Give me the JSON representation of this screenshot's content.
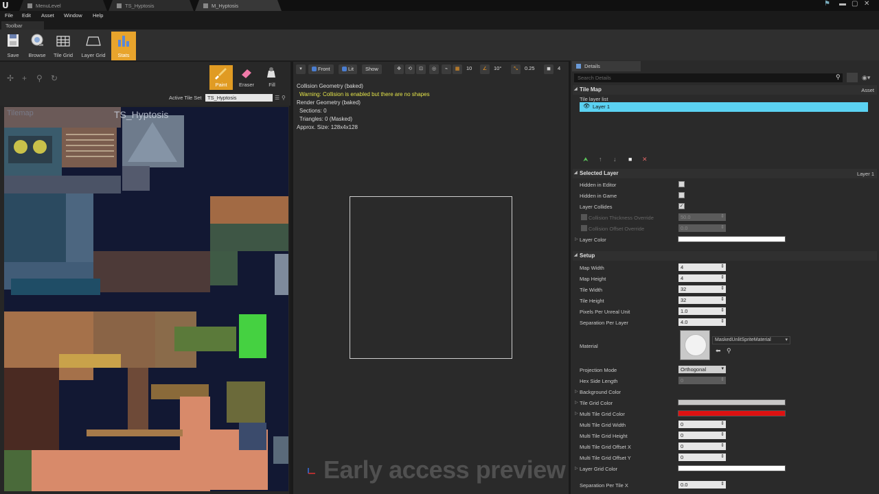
{
  "window": {
    "logo": "U",
    "tabs": [
      "MenuLevel",
      "TS_Hyptosis",
      "M_Hyptosis"
    ],
    "controls": {
      "user": "⚑",
      "minimize": "▬",
      "maximize": "▢",
      "close": "✕"
    }
  },
  "menu": [
    "File",
    "Edit",
    "Asset",
    "Window",
    "Help"
  ],
  "toolbar": {
    "tab_label": "Toolbar",
    "buttons": [
      {
        "label": "Save",
        "icon": "save-icon"
      },
      {
        "label": "Browse",
        "icon": "browse-icon"
      },
      {
        "label": "Tile Grid",
        "icon": "tile-grid-icon"
      },
      {
        "label": "Layer Grid",
        "icon": "layer-grid-icon"
      },
      {
        "label": "Stats",
        "icon": "stats-icon",
        "active": true
      }
    ]
  },
  "tools": {
    "buttons": [
      {
        "label": "Paint",
        "icon": "paint-brush-icon",
        "active": true
      },
      {
        "label": "Eraser",
        "icon": "eraser-icon"
      },
      {
        "label": "Fill",
        "icon": "fill-bucket-icon"
      }
    ],
    "active_tile_set_label": "Active Tile Set",
    "active_tile_set_value": "TS_Hyptosis",
    "tileset_title": "TS_Hyptosis",
    "tileset_subtitle": "Tilemap"
  },
  "viewport": {
    "buttons": {
      "view": "Front",
      "lit": "Lit",
      "show": "Show"
    },
    "grid_snap": "10",
    "rot_snap": "10°",
    "scale_snap": "0.25",
    "cam_speed": "4",
    "info": {
      "line1": "Collision Geometry (baked)",
      "warning": "Warning: Collision is enabled but there are no shapes",
      "line3": "Render Geometry (baked)",
      "sections": "Sections: 0",
      "triangles": "Triangles: 0 (Masked)",
      "size": "Approx. Size: 128x4x128"
    },
    "watermark": "Early access preview"
  },
  "details": {
    "tab": "Details",
    "search_placeholder": "Search Details",
    "tile_map": {
      "header": "Tile Map",
      "right": "Asset",
      "list_label": "Tile layer list",
      "layer_name": "Layer 1"
    },
    "selected_layer": {
      "header": "Selected Layer",
      "right": "Layer 1",
      "hidden_in_editor": "Hidden in Editor",
      "hidden_in_game": "Hidden in Game",
      "layer_collides": "Layer Collides",
      "collides_check": "✓",
      "thickness_label": "Collision Thickness Override",
      "thickness_value": "50.0",
      "offset_label": "Collision Offset Override",
      "offset_value": "0.0",
      "layer_color": "Layer Color"
    },
    "setup": {
      "header": "Setup",
      "rows": [
        {
          "label": "Map Width",
          "value": "4"
        },
        {
          "label": "Map Height",
          "value": "4"
        },
        {
          "label": "Tile Width",
          "value": "32"
        },
        {
          "label": "Tile Height",
          "value": "32"
        },
        {
          "label": "Pixels Per Unreal Unit",
          "value": "1.0"
        },
        {
          "label": "Separation Per Layer",
          "value": "4.0"
        }
      ],
      "material_label": "Material",
      "material_value": "MaskedUnlitSpriteMaterial",
      "projection_label": "Projection Mode",
      "projection_value": "Orthogonal",
      "hex_label": "Hex Side Length",
      "hex_value": "0",
      "bg_color_label": "Background Color",
      "tile_grid_color_label": "Tile Grid Color",
      "multi_grid_color_label": "Multi Tile Grid Color",
      "multi_rows": [
        {
          "label": "Multi Tile Grid Width",
          "value": "0"
        },
        {
          "label": "Multi Tile Grid Height",
          "value": "0"
        },
        {
          "label": "Multi Tile Grid Offset X",
          "value": "0"
        },
        {
          "label": "Multi Tile Grid Offset Y",
          "value": "0"
        }
      ],
      "layer_grid_color_label": "Layer Grid Color",
      "sep_tile_x_label": "Separation Per Tile X",
      "sep_tile_x_value": "0.0"
    },
    "colors": {
      "layer_color": "#ffffff",
      "tile_grid_color": "#c8c8c8",
      "multi_tile_grid_color": "#dd1111",
      "layer_grid_color": "#ffffff",
      "accent": "#e8a42c",
      "selection": "#5bd2f2"
    }
  }
}
